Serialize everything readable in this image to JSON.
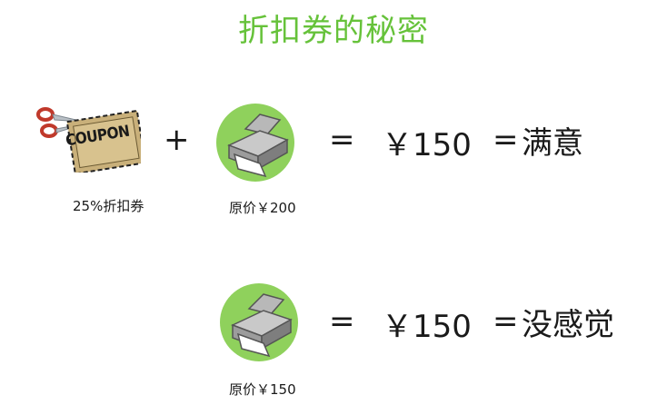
{
  "title": "折扣券的秘密",
  "row1": {
    "coupon": {
      "text": "COUPON",
      "caption": "25%折扣券"
    },
    "plus": "+",
    "printer": {
      "caption": "原价￥200"
    },
    "equals1": "=",
    "price": "￥150",
    "equals2": "=",
    "result": "满意"
  },
  "row2": {
    "printer": {
      "caption": "原价￥150"
    },
    "equals1": "=",
    "price": "￥150",
    "equals2": "=",
    "result": "没感觉"
  },
  "colors": {
    "title": "#66c23a",
    "circle": "#8fd15c",
    "coupon": "#c9b07a"
  }
}
